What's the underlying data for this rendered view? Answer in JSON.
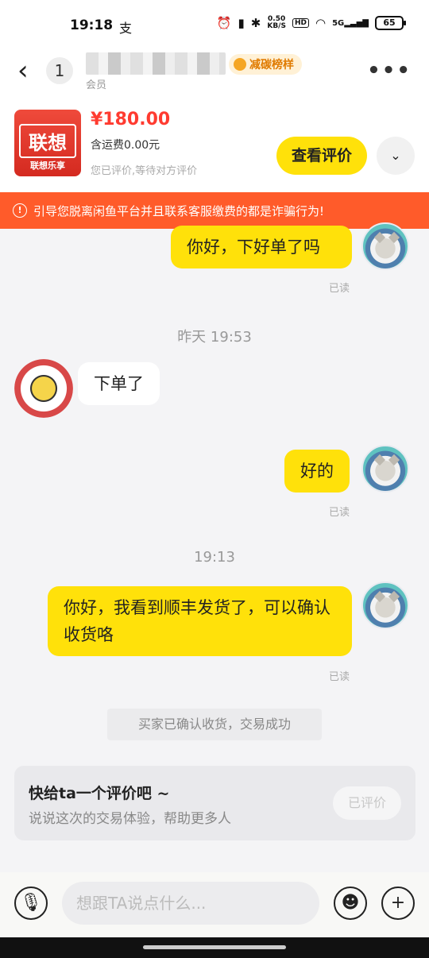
{
  "status_bar": {
    "time": "19:18",
    "alipay_glyph": "支",
    "net_speed_value": "0.50",
    "net_speed_unit": "KB/S",
    "hd_label": "HD",
    "network": "5G",
    "battery": "65"
  },
  "header": {
    "unread_count": "1",
    "sub_label": "会员",
    "badge_label": "减碳榜样"
  },
  "product": {
    "image_logo_text": "联想",
    "image_brand_text": "联想乐享",
    "price": "¥180.00",
    "shipping": "含运费0.00元",
    "status": "您已评价,等待对方评价",
    "view_review_label": "查看评价"
  },
  "warning": {
    "text": "引导您脱离闲鱼平台并且联系客服缴费的都是诈骗行为!"
  },
  "messages": {
    "m1": {
      "text": "你好，下好单了吗",
      "read": "已读"
    },
    "time1": "昨天 19:53",
    "m2": {
      "text": "下单了"
    },
    "m3": {
      "text": "好的",
      "read": "已读"
    },
    "time2": "19:13",
    "m4": {
      "text": "你好，我看到顺丰发货了，可以确认收货咯",
      "read": "已读"
    },
    "system": "买家已确认收货，交易成功"
  },
  "review_card": {
    "title": "快给ta一个评价吧 ~",
    "desc": "说说这次的交易体验，帮助更多人",
    "button": "已评价"
  },
  "input_bar": {
    "placeholder": "想跟TA说点什么..."
  },
  "colors": {
    "accent_yellow": "#ffe10a",
    "warning_orange": "#ff5b2a",
    "price_red": "#ff3b30"
  }
}
